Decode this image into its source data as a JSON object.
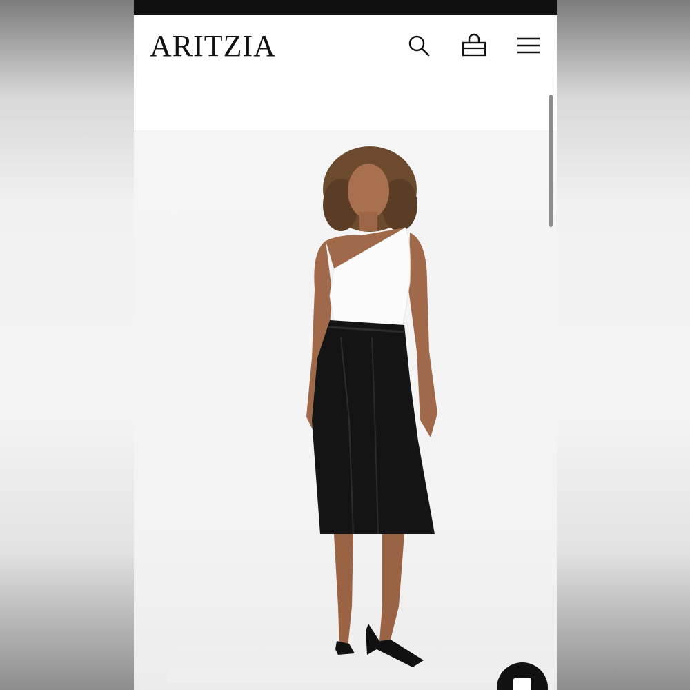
{
  "header": {
    "logo": "ARITZIA",
    "icons": {
      "search": "search-icon",
      "bag": "shopping-bag-icon",
      "menu": "hamburger-menu-icon"
    }
  },
  "product_image": {
    "content": "model-photo"
  },
  "chat": {
    "icon": "chat-icon"
  },
  "colors": {
    "status_bar": "#0f0f0f",
    "logo": "#111111",
    "background": "#f4f4f4"
  }
}
